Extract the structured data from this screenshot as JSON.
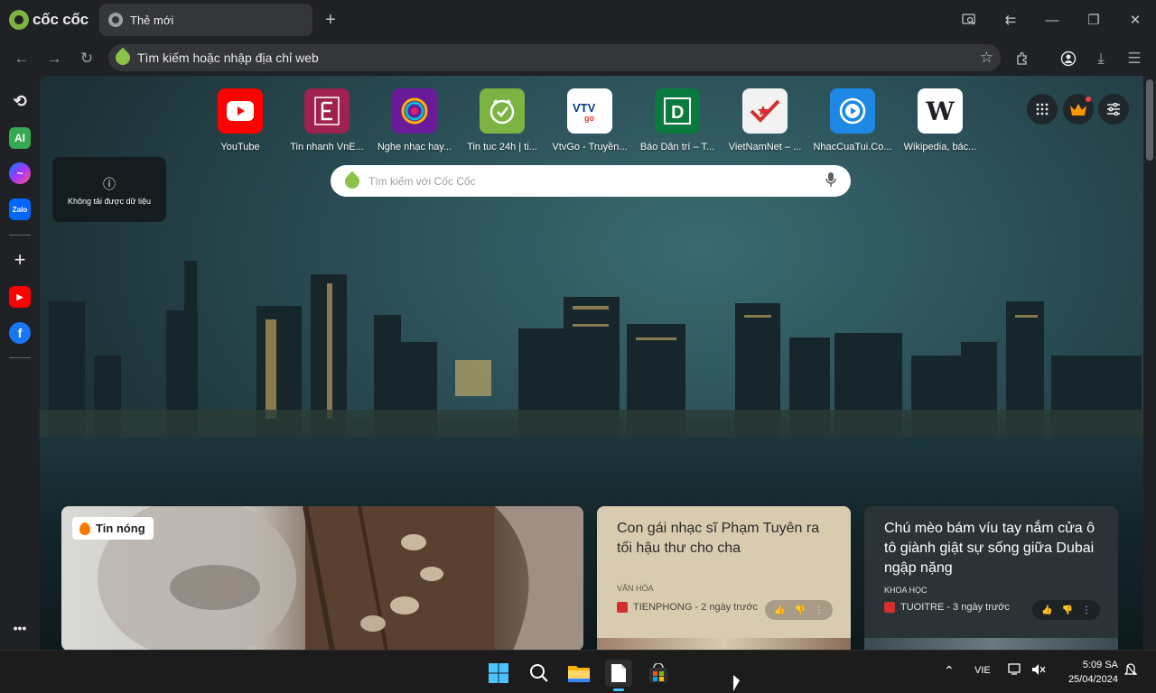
{
  "browser": {
    "brand": "cốc cốc",
    "tab_title": "Thẻ mới",
    "omnibox_placeholder": "Tìm kiếm hoặc nhập địa chỉ web"
  },
  "speed_dial": [
    {
      "label": "YouTube",
      "icon": "youtube-icon",
      "color": "#ff0000"
    },
    {
      "label": "Tin nhanh VnE...",
      "icon": "vnexpress-icon",
      "color": "#9f224e"
    },
    {
      "label": "Nghe nhạc hay...",
      "icon": "music-icon",
      "color": "#6a1b9a"
    },
    {
      "label": "Tin tuc 24h | ti...",
      "icon": "clock-icon",
      "color": "#7cb342"
    },
    {
      "label": "VtvGo - Truyền...",
      "icon": "vtvgo-icon",
      "color": "#ffffff"
    },
    {
      "label": "Báo Dân trí – T...",
      "icon": "dantri-icon",
      "color": "#0b7a3e"
    },
    {
      "label": "VietNamNet – ...",
      "icon": "vietnamnet-icon",
      "color": "#f2f2f2"
    },
    {
      "label": "NhacCuaTui.Co...",
      "icon": "nhaccuatui-icon",
      "color": "#1e88e5"
    },
    {
      "label": "Wikipedia, bác...",
      "icon": "wikipedia-icon",
      "color": "#ffffff"
    }
  ],
  "weather": {
    "message": "Không tải được dữ liệu"
  },
  "search": {
    "placeholder": "Tìm kiếm với Cốc Cốc"
  },
  "news": {
    "hot_label": "Tin nóng",
    "cards": [
      {
        "title": "Con gái nhạc sĩ Phạm Tuyên ra tối hậu thư cho cha",
        "category": "VĂN HÓA",
        "source": "TIENPHONG - 2 ngày trước"
      },
      {
        "title": "Chú mèo bám víu tay nắm cửa ô tô giành giật sự sống giữa Dubai ngập nặng",
        "category": "KHOA HỌC",
        "source": "TUOITRE - 3 ngày trước"
      }
    ]
  },
  "taskbar": {
    "language": "VIE",
    "time": "5:09 SA",
    "date": "25/04/2024"
  }
}
